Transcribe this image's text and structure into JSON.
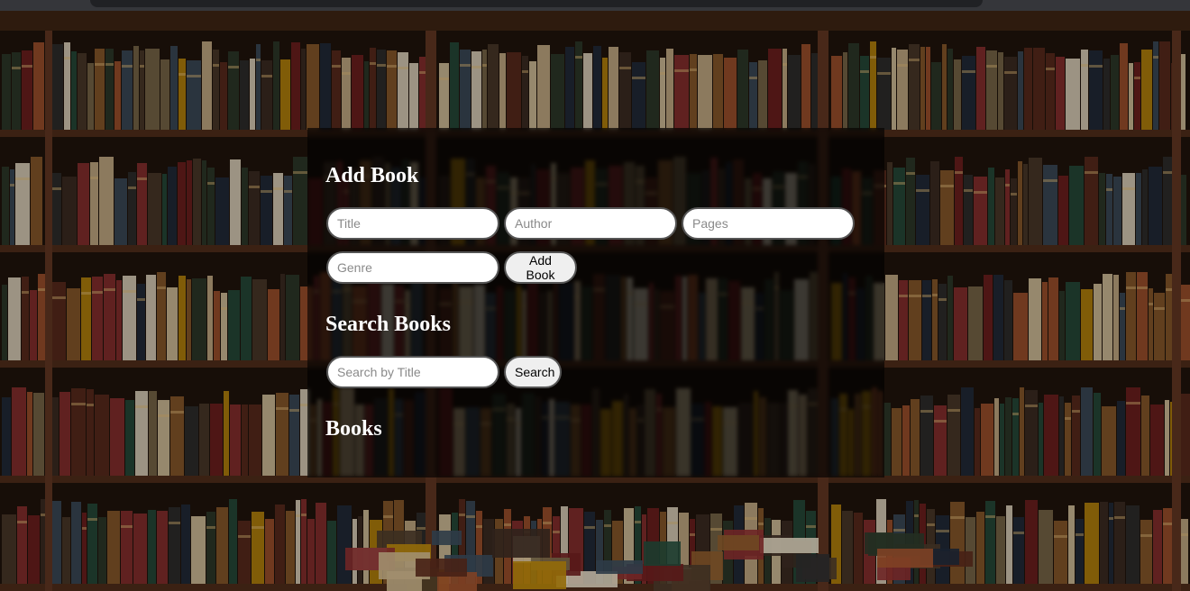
{
  "add_book": {
    "heading": "Add Book",
    "title_placeholder": "Title",
    "author_placeholder": "Author",
    "pages_placeholder": "Pages",
    "genre_placeholder": "Genre",
    "add_button_label": "Add Book"
  },
  "search_books": {
    "heading": "Search Books",
    "search_placeholder": "Search by Title",
    "search_button_label": "Search"
  },
  "books": {
    "heading": "Books",
    "items": []
  },
  "colors": {
    "panel_overlay": "rgba(0,0,0,0.62)",
    "heading_text": "#ffffff",
    "input_bg": "#ffffff",
    "button_bg": "#efefef"
  }
}
